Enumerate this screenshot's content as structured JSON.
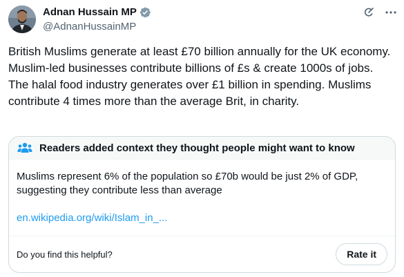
{
  "author": {
    "display_name": "Adnan Hussain MP",
    "handle": "@AdnanHussainMP"
  },
  "icons": {
    "verified": "verified-badge-icon",
    "grok": "grok-icon",
    "more": "more-icon",
    "note": "people-icon"
  },
  "colors": {
    "verified_badge": "#829aab",
    "link": "#1d9bf0",
    "secondary_text": "#536471",
    "community_note_accent": "#1d9bf0"
  },
  "tweet": {
    "text": "British Muslims generate at least £70 billion annually for the UK economy. Muslim-led businesses contribute billions of £s & create 1000s of jobs. The halal food industry generates over £1 billion in spending. Muslims contribute 4 times more than the average Brit, in charity."
  },
  "community_note": {
    "header": "Readers added context they thought people might want to know",
    "body": "Muslims represent 6% of the population so £70b would be just 2% of GDP, suggesting they contribute less than average",
    "link_text": "en.wikipedia.org/wiki/Islam_in_...",
    "helpful_question": "Do you find this helpful?",
    "rate_button": "Rate it"
  }
}
